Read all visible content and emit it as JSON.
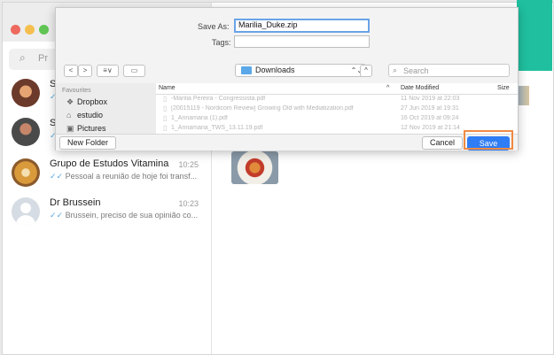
{
  "colors": {
    "accent": "#2f7df4",
    "teal": "#1fbf9f",
    "highlight": "#f08b43",
    "traffic_red": "#ee6a5e",
    "traffic_yellow": "#f5bf4f",
    "traffic_green": "#61c554",
    "tick_blue": "#58a6df"
  },
  "chat": {
    "search_icon": "search-icon",
    "search_placeholder": "Pr",
    "items": [
      {
        "name": "Sr",
        "time": "",
        "msg": "",
        "avatar_color": "#6b3a2a"
      },
      {
        "name": "Si",
        "time": "",
        "msg": "",
        "avatar_color": "#4a4a4a"
      },
      {
        "name": "Grupo de Estudos Vitamina",
        "time": "10:25",
        "msg": "Pessoal a reunião de hoje foi transf...",
        "avatar_color": "#d99a3c"
      },
      {
        "name": "Dr Brussein",
        "time": "10:23",
        "msg": "Brussein, preciso de sua opinião co...",
        "avatar_color": "#d6dce3"
      }
    ]
  },
  "dialog": {
    "save_as_label": "Save As:",
    "save_as_value": "Marilia_Duke.zip",
    "tags_label": "Tags:",
    "tags_value": "",
    "nav_back": "<",
    "nav_forward": ">",
    "view_mode": "≡∨",
    "new_folder_icon": "folder-icon",
    "location": "Downloads",
    "location_stepper": "⌃⌄",
    "up_icon": "^",
    "search_placeholder": "Search",
    "sidebar": {
      "header": "Favourites",
      "items": [
        {
          "label": "Dropbox",
          "icon": "dropbox-icon",
          "glyph": "❖"
        },
        {
          "label": "estudio",
          "icon": "home-icon",
          "glyph": "⌂"
        },
        {
          "label": "Pictures",
          "icon": "pictures-icon",
          "glyph": "▣"
        }
      ]
    },
    "columns": {
      "name": "Name",
      "sort": "^",
      "date": "Date Modified",
      "size": "Size"
    },
    "files": [
      {
        "name": "-Marilia Pereira - Congressista.pdf",
        "date": "11 Nov 2019 at 22:03"
      },
      {
        "name": "[20015119 - Nordicom Review] Growing Old with Mediatization.pdf",
        "date": "27 Jun 2019 at 19:31"
      },
      {
        "name": "1_Annamaria (1).pdf",
        "date": "16 Oct 2019 at 09:24"
      },
      {
        "name": "1_Annamaria_TWS_13.11.19.pdf",
        "date": "12 Nov 2019 at 21:14"
      }
    ],
    "new_folder_label": "New Folder",
    "cancel_label": "Cancel",
    "save_label": "Save"
  }
}
